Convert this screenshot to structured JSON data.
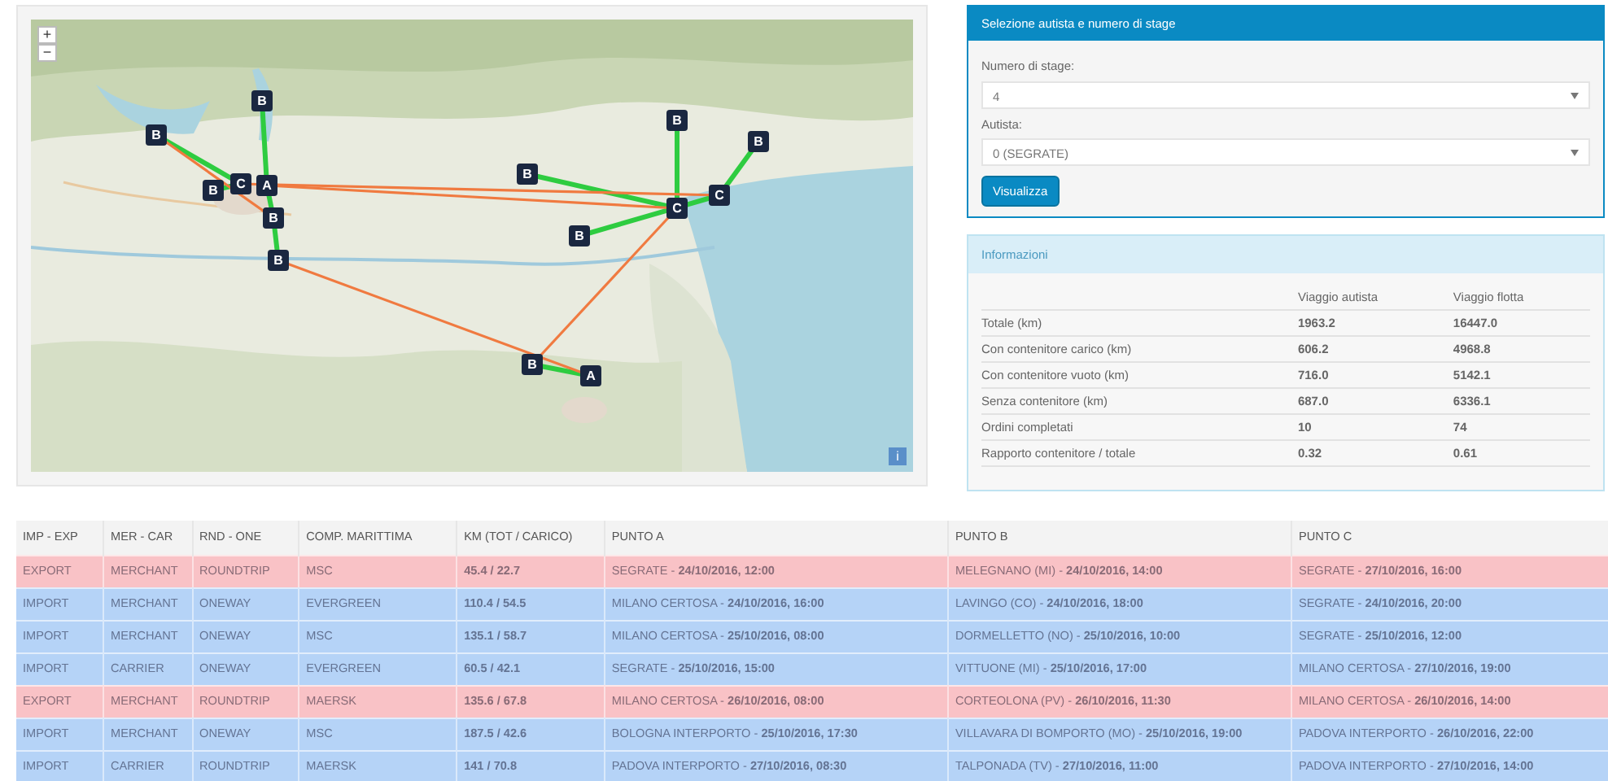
{
  "map": {
    "zoom_in": "+",
    "zoom_out": "−",
    "info": "i",
    "markers": [
      {
        "label": "B"
      },
      {
        "label": "B"
      },
      {
        "label": "B"
      },
      {
        "label": "C"
      },
      {
        "label": "A"
      },
      {
        "label": "B"
      },
      {
        "label": "B"
      },
      {
        "label": "B"
      },
      {
        "label": "B"
      },
      {
        "label": "B"
      },
      {
        "label": "C"
      },
      {
        "label": "C"
      },
      {
        "label": "B"
      },
      {
        "label": "B"
      },
      {
        "label": "A"
      }
    ]
  },
  "selection": {
    "title": "Selezione autista e numero di stage",
    "fields": [
      {
        "label": "Numero di stage:",
        "value": "4"
      },
      {
        "label": "Autista:",
        "value": "0 (SEGRATE)"
      }
    ],
    "button": "Visualizza"
  },
  "info": {
    "title": "Informazioni",
    "columns": [
      "",
      "Viaggio autista",
      "Viaggio flotta"
    ],
    "rows": [
      [
        "Totale (km)",
        "1963.2",
        "16447.0"
      ],
      [
        "Con contenitore carico (km)",
        "606.2",
        "4968.8"
      ],
      [
        "Con contenitore vuoto (km)",
        "716.0",
        "5142.1"
      ],
      [
        "Senza contenitore (km)",
        "687.0",
        "6336.1"
      ],
      [
        "Ordini completati",
        "10",
        "74"
      ],
      [
        "Rapporto contenitore / totale",
        "0.32",
        "0.61"
      ]
    ]
  },
  "table": {
    "columns": [
      "IMP - EXP",
      "MER - CAR",
      "RND - ONE",
      "COMP. MARITTIMA",
      "KM (TOT / CARICO)",
      "PUNTO A",
      "PUNTO B",
      "PUNTO C"
    ],
    "rows": [
      {
        "color": "#f9c2c6",
        "cells": [
          "EXPORT",
          "MERCHANT",
          "ROUNDTRIP",
          "MSC",
          "45.4 / 22.7",
          "SEGRATE - **24/10/2016, 12:00**",
          "MELEGNANO (MI) - **24/10/2016, 14:00**",
          "SEGRATE - **27/10/2016, 16:00**"
        ]
      },
      {
        "color": "#b5d3f7",
        "cells": [
          "IMPORT",
          "MERCHANT",
          "ONEWAY",
          "EVERGREEN",
          "110.4 / 54.5",
          "MILANO CERTOSA - **24/10/2016, 16:00**",
          "LAVINGO (CO) - **24/10/2016, 18:00**",
          "SEGRATE - **24/10/2016, 20:00**"
        ]
      },
      {
        "color": "#b5d3f7",
        "cells": [
          "IMPORT",
          "MERCHANT",
          "ONEWAY",
          "MSC",
          "135.1 / 58.7",
          "MILANO CERTOSA - **25/10/2016, 08:00**",
          "DORMELLETTO (NO) - **25/10/2016, 10:00**",
          "SEGRATE - **25/10/2016, 12:00**"
        ]
      },
      {
        "color": "#b5d3f7",
        "cells": [
          "IMPORT",
          "CARRIER",
          "ONEWAY",
          "EVERGREEN",
          "60.5 / 42.1",
          "SEGRATE - **25/10/2016, 15:00**",
          "VITTUONE (MI) - **25/10/2016, 17:00**",
          "MILANO CERTOSA - **27/10/2016, 19:00**"
        ]
      },
      {
        "color": "#f9c2c6",
        "cells": [
          "EXPORT",
          "MERCHANT",
          "ROUNDTRIP",
          "MAERSK",
          "135.6 / 67.8",
          "MILANO CERTOSA - **26/10/2016, 08:00**",
          "CORTEOLONA (PV) - **26/10/2016, 11:30**",
          "MILANO CERTOSA - **26/10/2016, 14:00**"
        ]
      },
      {
        "color": "#b5d3f7",
        "cells": [
          "IMPORT",
          "MERCHANT",
          "ONEWAY",
          "MSC",
          "187.5 / 42.6",
          "BOLOGNA INTERPORTO - **25/10/2016, 17:30**",
          "VILLAVARA DI BOMPORTO (MO) - **25/10/2016, 19:00**",
          "PADOVA INTERPORTO - **26/10/2016, 22:00**"
        ]
      },
      {
        "color": "#b5d3f7",
        "cells": [
          "IMPORT",
          "CARRIER",
          "ROUNDTRIP",
          "MAERSK",
          "141 / 70.8",
          "PADOVA INTERPORTO - **27/10/2016, 08:30**",
          "TALPONADA (TV) - **27/10/2016, 11:00**",
          "PADOVA INTERPORTO - **27/10/2016, 14:00**"
        ]
      }
    ]
  }
}
